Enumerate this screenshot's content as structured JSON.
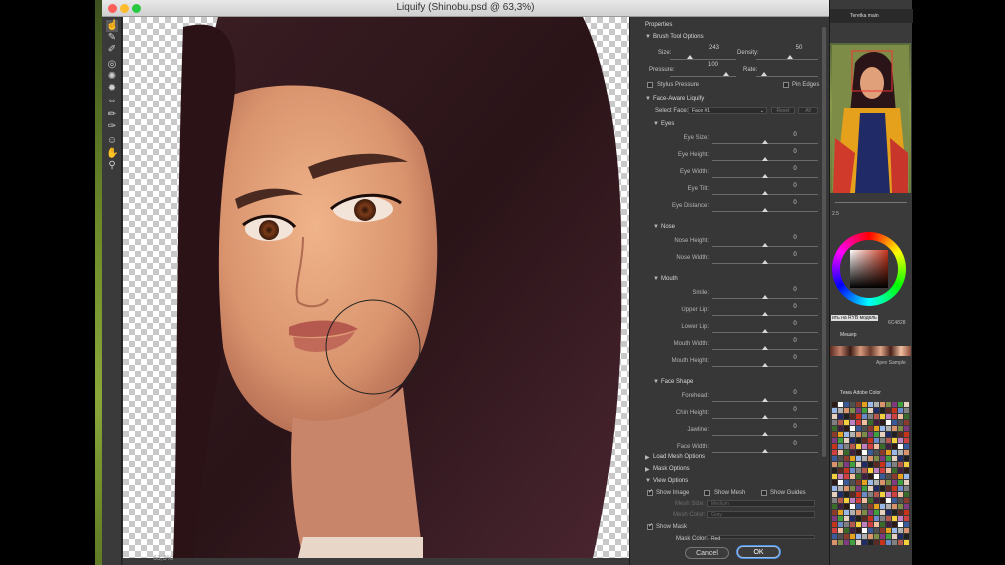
{
  "window": {
    "title": "Liquify (Shinobu.psd @ 63,3%)",
    "zoom": "63,3%"
  },
  "tools": [
    "forward-warp-icon",
    "reconstruct-icon",
    "smooth-icon",
    "twirl-icon",
    "pucker-icon",
    "bloat-icon",
    "push-left-icon",
    "freeze-mask-icon",
    "thaw-mask-icon",
    "face-tool-icon",
    "hand-icon",
    "zoom-icon"
  ],
  "properties": {
    "title": "Properties",
    "brush_tool_options": {
      "header": "Brush Tool Options",
      "size_label": "Size:",
      "size_value": "243",
      "density_label": "Density:",
      "density_value": "50",
      "pressure_label": "Pressure:",
      "pressure_value": "100",
      "rate_label": "Rate:",
      "rate_value": "",
      "stylus_label": "Stylus Pressure",
      "pin_edges_label": "Pin Edges"
    },
    "face_aware": {
      "header": "Face-Aware Liquify",
      "select_face_label": "Select Face:",
      "select_face_value": "Face #1",
      "reset_label": "Reset",
      "all_label": "All",
      "groups": [
        {
          "name": "Eyes",
          "sliders": [
            {
              "label": "Eye Size:",
              "value": "0"
            },
            {
              "label": "Eye Height:",
              "value": "0"
            },
            {
              "label": "Eye Width:",
              "value": "0"
            },
            {
              "label": "Eye Tilt:",
              "value": "0"
            },
            {
              "label": "Eye Distance:",
              "value": "0"
            }
          ]
        },
        {
          "name": "Nose",
          "sliders": [
            {
              "label": "Nose Height:",
              "value": "0"
            },
            {
              "label": "Nose Width:",
              "value": "0"
            }
          ]
        },
        {
          "name": "Mouth",
          "sliders": [
            {
              "label": "Smile:",
              "value": "0"
            },
            {
              "label": "Upper Lip:",
              "value": "0"
            },
            {
              "label": "Lower Lip:",
              "value": "0"
            },
            {
              "label": "Mouth Width:",
              "value": "0"
            },
            {
              "label": "Mouth Height:",
              "value": "0"
            }
          ]
        },
        {
          "name": "Face Shape",
          "sliders": [
            {
              "label": "Forehead:",
              "value": "0"
            },
            {
              "label": "Chin Height:",
              "value": "0"
            },
            {
              "label": "Jawline:",
              "value": "0"
            },
            {
              "label": "Face Width:",
              "value": "0"
            }
          ]
        }
      ]
    },
    "load_mesh_options": "Load Mesh Options",
    "mask_options": "Mask Options",
    "view_options": {
      "header": "View Options",
      "show_image": "Show Image",
      "show_mesh": "Show Mesh",
      "show_guides": "Show Guides",
      "mesh_size_label": "Mesh Size:",
      "mesh_size_value": "Medium",
      "mesh_color_label": "Mesh Color:",
      "mesh_color_value": "Gray",
      "show_mask": "Show Mask",
      "mask_color_label": "Mask Color:",
      "mask_color_value": "Red"
    },
    "cancel_label": "Cancel",
    "ok_label": "OK"
  },
  "right_panel": {
    "workspace": "Teretka main",
    "size_readout": "2.5",
    "color_label": "ить на RYB модель",
    "hex_value": "6C4828",
    "mixer_label": "Мешер",
    "sample_label": "Apex Sample",
    "adobe_color_label": "Тема Adobe Color"
  },
  "colors": {
    "accent_blue": "#4a90e2",
    "hair": "#2a1418",
    "skin": "#d9946e",
    "lips": "#b5594e"
  }
}
